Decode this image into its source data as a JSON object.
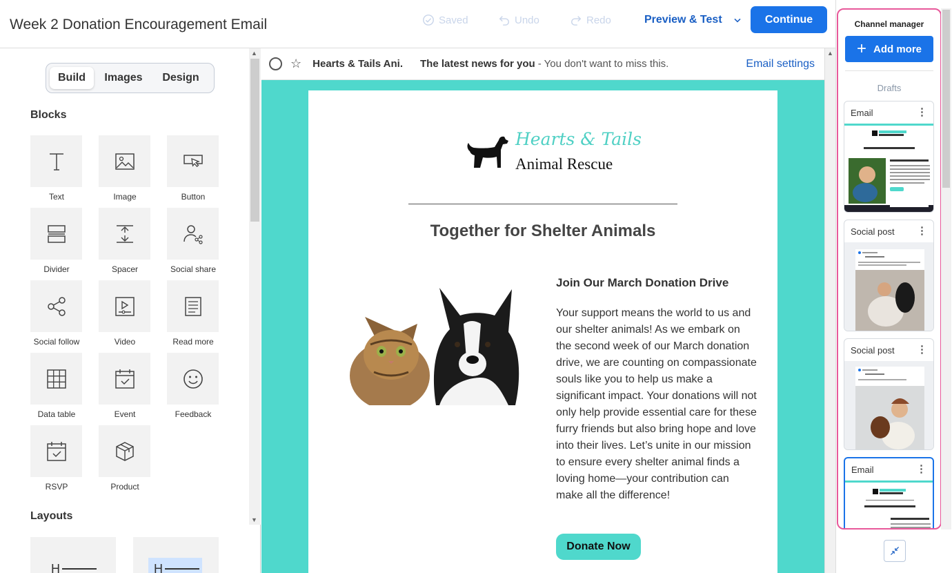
{
  "header": {
    "title": "Week 2 Donation Encouragement Email",
    "saved_label": "Saved",
    "undo_label": "Undo",
    "redo_label": "Redo",
    "preview_label": "Preview & Test",
    "continue_label": "Continue"
  },
  "left_panel": {
    "tabs": [
      "Build",
      "Images",
      "Design"
    ],
    "active_tab": "Build",
    "blocks_title": "Blocks",
    "blocks": [
      {
        "label": "Text",
        "icon": "text-icon"
      },
      {
        "label": "Image",
        "icon": "image-icon"
      },
      {
        "label": "Button",
        "icon": "button-cursor-icon"
      },
      {
        "label": "Divider",
        "icon": "divider-icon"
      },
      {
        "label": "Spacer",
        "icon": "spacer-icon"
      },
      {
        "label": "Social share",
        "icon": "social-share-icon"
      },
      {
        "label": "Social follow",
        "icon": "share-nodes-icon"
      },
      {
        "label": "Video",
        "icon": "video-icon"
      },
      {
        "label": "Read more",
        "icon": "document-lines-icon"
      },
      {
        "label": "Data table",
        "icon": "grid-table-icon"
      },
      {
        "label": "Event",
        "icon": "calendar-check-icon"
      },
      {
        "label": "Feedback",
        "icon": "smiley-icon"
      },
      {
        "label": "RSVP",
        "icon": "calendar-check-icon"
      },
      {
        "label": "Product",
        "icon": "box-icon"
      }
    ],
    "layouts_title": "Layouts",
    "layout_glyph": "H"
  },
  "inbox_preview": {
    "sender": "Hearts & Tails Ani.",
    "subject": "The latest news for you",
    "preheader": " - You don't want to miss this.",
    "settings_label": "Email settings"
  },
  "email": {
    "logo_script": "Hearts & Tails",
    "logo_text": "Animal Rescue",
    "headline": "Together for Shelter Animals",
    "subheading": "Join Our March Donation Drive",
    "body": "Your support means the world to us and our shelter animals! As we embark on the second week of our March donation drive, we are counting on compassionate souls like you to help us make a significant impact. Your donations will not only help provide essential care for these furry friends but also bring hope and love into their lives. Let’s unite in our mission to ensure every shelter animal finds a loving home—your contribution can make all the difference!",
    "button_label": "Donate Now",
    "background_color": "#4fd8cc"
  },
  "channel_manager": {
    "title": "Channel manager",
    "add_label": "Add more",
    "drafts_label": "Drafts",
    "cards": [
      {
        "type": "Email",
        "selected": false
      },
      {
        "type": "Social post",
        "selected": false
      },
      {
        "type": "Social post",
        "selected": false
      },
      {
        "type": "Email",
        "selected": true
      }
    ],
    "highlight_color": "#e8589a"
  },
  "colors": {
    "primary": "#1a73e8",
    "teal": "#4fd8cc"
  }
}
